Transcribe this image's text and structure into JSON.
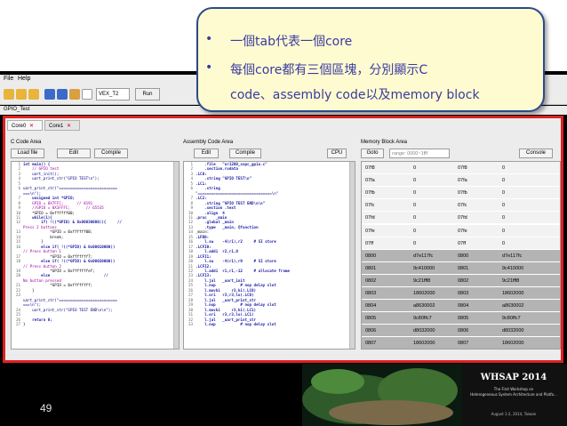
{
  "menu": {
    "file": "File",
    "help": "Help"
  },
  "toolbar": {
    "target_select": "VEX_T2",
    "run_label": "Run"
  },
  "window_title": "GPIO_Test",
  "tabs": [
    {
      "label": "Core0"
    },
    {
      "label": "Core1"
    }
  ],
  "tab_close": "✕",
  "c_code": {
    "title": "C Code Area",
    "buttons": {
      "load": "Load file",
      "edit": "Edit",
      "compile": "Compile"
    }
  },
  "asm": {
    "title": "Assembly Code Area",
    "buttons": {
      "edit": "Edit",
      "compile": "Compile",
      "cpu": "CPU"
    }
  },
  "memory": {
    "title": "Memory Block Area",
    "buttons": {
      "goto": "Goto",
      "console": "Console"
    },
    "range_placeholder": "range: 0000~1fff",
    "rows": [
      [
        "07f8",
        "0",
        "07f8",
        "0"
      ],
      [
        "07fa",
        "0",
        "07fa",
        "0"
      ],
      [
        "07fb",
        "0",
        "07fb",
        "0"
      ],
      [
        "07fc",
        "0",
        "07fc",
        "0"
      ],
      [
        "07fd",
        "0",
        "07fd",
        "0"
      ],
      [
        "07fe",
        "0",
        "07fe",
        "0"
      ],
      [
        "07ff",
        "0",
        "07ff",
        "0"
      ],
      [
        "0800",
        "d7e117fc",
        "0800",
        "d7e117fc"
      ],
      [
        "0801",
        "9c410000",
        "0801",
        "9c410000"
      ],
      [
        "0802",
        "9c21fff8",
        "0802",
        "9c21fff8"
      ],
      [
        "0803",
        "18602000",
        "0803",
        "18602000"
      ],
      [
        "0804",
        "a8630002",
        "0804",
        "a8630002"
      ],
      [
        "0805",
        "9c80ffc7",
        "0805",
        "9c80ffc7"
      ],
      [
        "0806",
        "d8032000",
        "0806",
        "d8032000"
      ],
      [
        "0807",
        "18602000",
        "0807",
        "18602000"
      ]
    ]
  },
  "c_lines": [
    {
      "n": "1",
      "t": "int main() {"
    },
    {
      "n": "2",
      "t": "    // GPIO test"
    },
    {
      "n": "3",
      "t": "    uart_init();"
    },
    {
      "n": "4",
      "t": "    uart_print_str(\"GPIO TEST\\n\");"
    },
    {
      "n": "5",
      "t": ""
    },
    {
      "n": "6",
      "t": "uart_print_str(\"=========================="
    },
    {
      "n": "",
      "t": "===\\n\");"
    },
    {
      "n": "7",
      "t": "    unsigned int *GPIO;"
    },
    {
      "n": "8",
      "t": "    GPIO = 0X7FFC;      // 8191"
    },
    {
      "n": "9",
      "t": "    //GPIO = 0X3FFFC;       // 65535"
    },
    {
      "n": "10",
      "t": "    *GPIO = 0xffffff00;"
    },
    {
      "n": "11",
      "t": "    while(1){"
    },
    {
      "n": "12",
      "t": "        if( !((*GPIO) & 0x00030000)){     //"
    },
    {
      "n": "",
      "t": "Press 2 buttons"
    },
    {
      "n": "13",
      "t": "            *GPIO = 0xffffff00;"
    },
    {
      "n": "14",
      "t": "            break;"
    },
    {
      "n": "15",
      "t": "        }"
    },
    {
      "n": "16",
      "t": "        else if( !((*GPIO) & 0x00010000))"
    },
    {
      "n": "",
      "t": "// Press button 1"
    },
    {
      "n": "17",
      "t": "            *GPIO = 0xfffffff7;"
    },
    {
      "n": "18",
      "t": "        else if( !((*GPIO) & 0x00020000))"
    },
    {
      "n": "",
      "t": "// Press button 2"
    },
    {
      "n": "19",
      "t": "            *GPIO = 0xfffffffef;"
    },
    {
      "n": "20",
      "t": "        else                        //"
    },
    {
      "n": "",
      "t": "No button pressed"
    },
    {
      "n": "21",
      "t": "            *GPIO = 0xffffffff;"
    },
    {
      "n": "22",
      "t": "    }"
    },
    {
      "n": "23",
      "t": ""
    },
    {
      "n": "",
      "t": "uart_print_str(\"=========================="
    },
    {
      "n": "",
      "t": "===\\n\");"
    },
    {
      "n": "24",
      "t": "    uart_print_str(\"GPIO TEST END\\n\\n\");"
    },
    {
      "n": "25",
      "t": ""
    },
    {
      "n": "26",
      "t": "    return 0;"
    },
    {
      "n": "27",
      "t": "}"
    }
  ],
  "asm_lines": [
    {
      "n": "1",
      "t": "    .file   \"or1200_sopc_gpio.c\""
    },
    {
      "n": "2",
      "t": "    .section.rodata"
    },
    {
      "n": "3",
      "t": ".LC0:"
    },
    {
      "n": "4",
      "t": "    .string \"GPIO TEST\\n\""
    },
    {
      "n": "5",
      "t": ".LC1:"
    },
    {
      "n": "6",
      "t": "    .string"
    },
    {
      "n": "",
      "t": "\"=================================\\n\""
    },
    {
      "n": "7",
      "t": ".LC2:"
    },
    {
      "n": "8",
      "t": "    .string \"GPIO TEST END\\n\\n\""
    },
    {
      "n": "9",
      "t": "    .section .text"
    },
    {
      "n": "10",
      "t": "    .align  4"
    },
    {
      "n": "11",
      "t": ".proc    _main"
    },
    {
      "n": "12",
      "t": "    .global _main"
    },
    {
      "n": "13",
      "t": "    .type   _main, @function"
    },
    {
      "n": "14",
      "t": "_main:"
    },
    {
      "n": "15",
      "t": ".LFB0:"
    },
    {
      "n": "16",
      "t": "    l.sw    -4(r1),r2     # SI store"
    },
    {
      "n": "17",
      "t": ".LCFI0:"
    },
    {
      "n": "18",
      "t": "    l.addi  r2,r1,0"
    },
    {
      "n": "19",
      "t": ".LCFI1:"
    },
    {
      "n": "20",
      "t": "    l.sw    -4(r1),r9     # SI store"
    },
    {
      "n": "21",
      "t": ".LCFI2:"
    },
    {
      "n": "22",
      "t": "    l.addi  r1,r1,-12     # allocate frame"
    },
    {
      "n": "23",
      "t": ".LCFI3:"
    },
    {
      "n": "24",
      "t": "    l.jal   _uart_init"
    },
    {
      "n": "25",
      "t": "    l.nop           # nop delay slot"
    },
    {
      "n": "26",
      "t": "    l.movhi     r3,hi(.LC0)"
    },
    {
      "n": "27",
      "t": "    l.ori   r3,r3,lo(.LC0)"
    },
    {
      "n": "28",
      "t": "    l.jal   _uart_print_str"
    },
    {
      "n": "29",
      "t": "    l.nop           # nop delay slot"
    },
    {
      "n": "30",
      "t": "    l.movhi     r3,hi(.LC1)"
    },
    {
      "n": "31",
      "t": "    l.ori   r3,r3,lo(.LC1)"
    },
    {
      "n": "32",
      "t": "    l.jal   _uart_print_str"
    },
    {
      "n": "33",
      "t": "    l.nop           # nop delay slot"
    }
  ],
  "callout": {
    "bullet": "•",
    "line1": "一個tab代表一個core",
    "line2": "每個core都有三個區塊，分別顯示C",
    "line3": "code、assembly code以及memory block"
  },
  "page_number": "49",
  "logo": {
    "title": "WHSAP  2014",
    "subtitle1": "The First Workshop on",
    "subtitle2": "Heterogeneous System Architecture and Platfo...",
    "date": "August 1-2, 2014, Taiwan"
  }
}
